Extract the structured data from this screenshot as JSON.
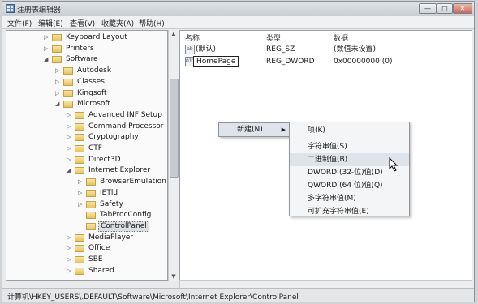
{
  "window": {
    "title": "注册表编辑器",
    "buttons": {
      "minimize": "—",
      "maximize": "□",
      "close": "✕"
    }
  },
  "menubar": [
    "文件(F)",
    "编辑(E)",
    "查看(V)",
    "收藏夹(A)",
    "帮助(H)"
  ],
  "tree": [
    {
      "label": "Keyboard Layout",
      "depth": 2,
      "exp": "▷"
    },
    {
      "label": "Printers",
      "depth": 2,
      "exp": "▷"
    },
    {
      "label": "Software",
      "depth": 2,
      "exp": "◢"
    },
    {
      "label": "Autodesk",
      "depth": 3,
      "exp": "▷"
    },
    {
      "label": "Classes",
      "depth": 3,
      "exp": "▷"
    },
    {
      "label": "Kingsoft",
      "depth": 3,
      "exp": "▷"
    },
    {
      "label": "Microsoft",
      "depth": 3,
      "exp": "◢"
    },
    {
      "label": "Advanced INF Setup",
      "depth": 4,
      "exp": "▷"
    },
    {
      "label": "Command Processor",
      "depth": 4,
      "exp": "▷"
    },
    {
      "label": "Cryptography",
      "depth": 4,
      "exp": "▷"
    },
    {
      "label": "CTF",
      "depth": 4,
      "exp": "▷"
    },
    {
      "label": "Direct3D",
      "depth": 4,
      "exp": "▷"
    },
    {
      "label": "Internet Explorer",
      "depth": 4,
      "exp": "◢"
    },
    {
      "label": "BrowserEmulation",
      "depth": 5,
      "exp": "▷"
    },
    {
      "label": "IETld",
      "depth": 5,
      "exp": "▷"
    },
    {
      "label": "Safety",
      "depth": 5,
      "exp": "▷"
    },
    {
      "label": "TabProcConfig",
      "depth": 5,
      "exp": ""
    },
    {
      "label": "ControlPanel",
      "depth": 5,
      "exp": "",
      "selected": true
    },
    {
      "label": "MediaPlayer",
      "depth": 4,
      "exp": "▷"
    },
    {
      "label": "Office",
      "depth": 4,
      "exp": "▷"
    },
    {
      "label": "SBE",
      "depth": 4,
      "exp": "▷"
    },
    {
      "label": "Shared",
      "depth": 4,
      "exp": "▷"
    }
  ],
  "list": {
    "headers": {
      "name": "名称",
      "type": "类型",
      "data": "数据"
    },
    "rows": [
      {
        "name": "(默认)",
        "type": "REG_SZ",
        "data": "(数值未设置)",
        "icon": "ab"
      },
      {
        "name": "HomePage",
        "type": "REG_DWORD",
        "data": "0x00000000 (0)",
        "icon": "011",
        "editing": true
      }
    ]
  },
  "context_menu": {
    "new_label": "新建(N)",
    "submenu": [
      "项(K)",
      "字符串值(S)",
      "二进制值(B)",
      "DWORD (32-位)值(D)",
      "QWORD (64 位)值(Q)",
      "多字符串值(M)",
      "可扩充字符串值(E)"
    ],
    "hover_index": 2
  },
  "statusbar": {
    "path": "计算机\\HKEY_USERS\\.DEFAULT\\Software\\Microsoft\\Internet Explorer\\ControlPanel"
  }
}
